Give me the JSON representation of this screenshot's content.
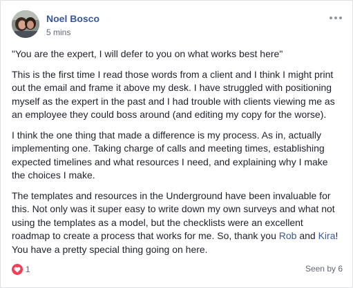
{
  "post": {
    "author": "Noel Bosco",
    "timestamp": "5 mins",
    "paragraphs": {
      "p1": "\"You are the expert, I will defer to you on what works best here\"",
      "p2": "This is the first time I read those words from a client and I think I might print out the email and frame it above my desk. I have struggled with positioning myself as the expert in the past and I had trouble with clients viewing me as an employee they could boss around (and editing my copy for the worse).",
      "p3": "I think the one thing that made a difference is my process. As in, actually implementing one. Taking charge of calls and meeting times, establishing expected timelines and what resources I need, and explaining why I make the choices I make.",
      "p4_before": "The templates and resources in the Underground have been invaluable for this. Not only was it super easy to write down my own surveys and what not using the templates as a model, but the checklists were an excellent roadmap to create a process that works for me. So, thank you ",
      "p4_link1": "Rob",
      "p4_and": " and ",
      "p4_link2": "Kira",
      "p4_after": "! You have a pretty special thing going on here."
    }
  },
  "footer": {
    "reaction_count": "1",
    "seen_by": "Seen by 6"
  },
  "icons": {
    "reaction": "heart-icon",
    "menu": "more-icon",
    "seen": "check-icon"
  },
  "colors": {
    "link": "#365899",
    "heart": "#f33e58",
    "meta": "#616770"
  }
}
